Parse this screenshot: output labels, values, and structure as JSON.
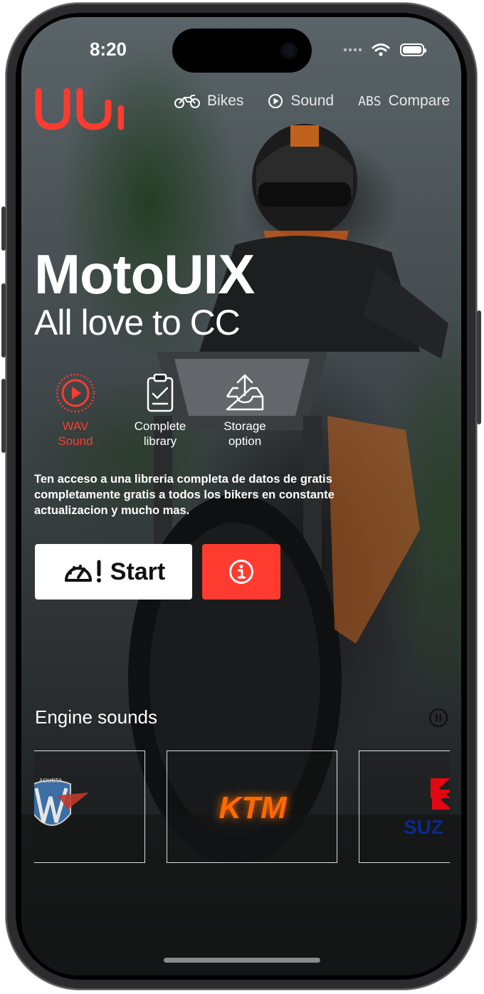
{
  "status": {
    "time": "8:20"
  },
  "nav": {
    "items": [
      {
        "label": "Bikes",
        "icon": "motorcycle-icon"
      },
      {
        "label": "Sound",
        "icon": "play-circle-icon"
      },
      {
        "label": "Compare",
        "icon": "abs-icon",
        "icon_text": "ABS"
      }
    ]
  },
  "hero": {
    "title": "MotoUIX",
    "subtitle": "All love to CC"
  },
  "features": [
    {
      "label": "WAV\nSound",
      "icon": "play-ring-icon",
      "active": true
    },
    {
      "label": "Complete\nlibrary",
      "icon": "clipboard-check-icon",
      "active": false
    },
    {
      "label": "Storage\noption",
      "icon": "upload-tray-icon",
      "active": false
    }
  ],
  "description": "Ten acceso a una libreria completa de datos de  gratis completamente gratis a todos los bikers en constante actualizacion y mucho mas.",
  "actions": {
    "start_label": "Start",
    "info_icon": "info-icon"
  },
  "engine_sounds": {
    "title": "Engine sounds",
    "brands": [
      {
        "name": "MV Agusta",
        "logo_text": "MV",
        "logo_subtext": "AGUSTA"
      },
      {
        "name": "KTM",
        "logo_text": "KTM",
        "selected": true
      },
      {
        "name": "Suzuki",
        "logo_text": "SUZ"
      }
    ]
  },
  "colors": {
    "accent": "#ff3b30",
    "ktm_orange": "#ff6a00",
    "suzuki_red": "#e30613",
    "suzuki_blue": "#0a2a8c"
  }
}
